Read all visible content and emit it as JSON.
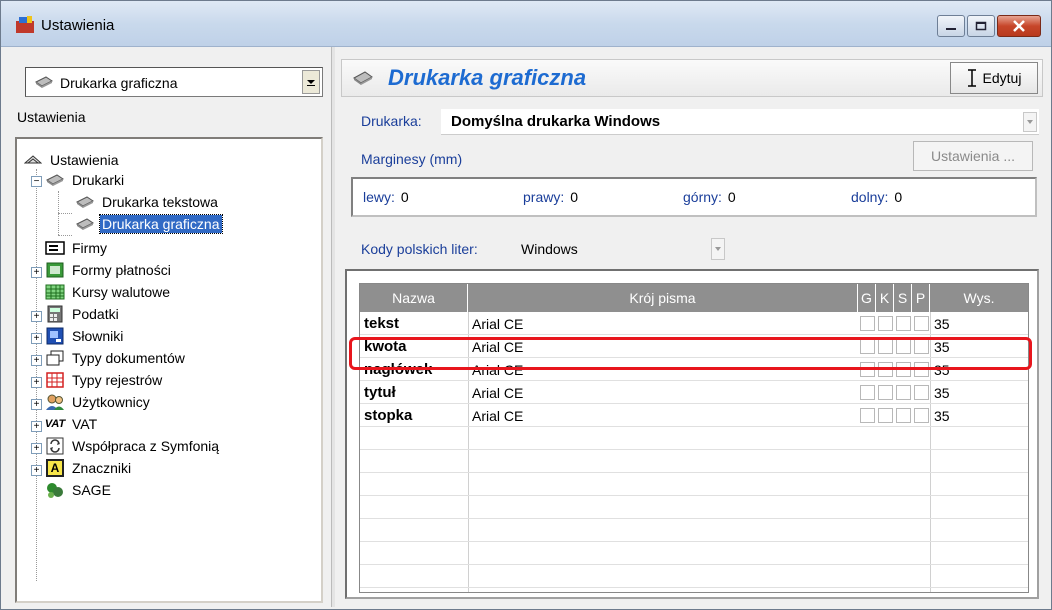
{
  "window": {
    "title": "Ustawienia",
    "accent": "#1d6bd1",
    "highlight_color": "#e8161d"
  },
  "left": {
    "combo_value": "Drukarka graficzna",
    "section_label": "Ustawienia",
    "tree": {
      "root": "Ustawienia",
      "drukarki": "Drukarki",
      "drukarka_tekstowa": "Drukarka tekstowa",
      "drukarka_graficzna": "Drukarka graficzna",
      "firmy": "Firmy",
      "formy_platnosci": "Formy płatności",
      "kursy_walutowe": "Kursy walutowe",
      "podatki": "Podatki",
      "slowniki": "Słowniki",
      "typy_dokumentow": "Typy dokumentów",
      "typy_rejestrow": "Typy rejestrów",
      "uzytkownicy": "Użytkownicy",
      "vat_icon_text": "VAT",
      "vat": "VAT",
      "wspolpraca": "Współpraca z Symfonią",
      "znaczniki": "Znaczniki",
      "znaczniki_icon_text": "A",
      "sage": "SAGE"
    }
  },
  "right": {
    "header_title": "Drukarka graficzna",
    "edit_label": "Edytuj",
    "printer_label": "Drukarka:",
    "printer_value": "Domyślna drukarka Windows",
    "margins_label": "Marginesy (mm)",
    "settings_button": "Ustawienia ...",
    "margins": {
      "left_label": "lewy:",
      "left_value": "0",
      "right_label": "prawy:",
      "right_value": "0",
      "top_label": "górny:",
      "top_value": "0",
      "bottom_label": "dolny:",
      "bottom_value": "0"
    },
    "codes_label": "Kody polskich liter:",
    "codes_value": "Windows",
    "grid": {
      "headers": {
        "name": "Nazwa",
        "font": "Krój pisma",
        "g": "G",
        "k": "K",
        "s": "S",
        "p": "P",
        "height": "Wys."
      },
      "rows": [
        {
          "name": "tekst",
          "font": "Arial CE",
          "height": "35"
        },
        {
          "name": "kwota",
          "font": "Arial CE",
          "height": "35"
        },
        {
          "name": "nagłówek",
          "font": "Arial CE",
          "height": "35"
        },
        {
          "name": "tytuł",
          "font": "Arial CE",
          "height": "35"
        },
        {
          "name": "stopka",
          "font": "Arial CE",
          "height": "35"
        }
      ]
    }
  }
}
